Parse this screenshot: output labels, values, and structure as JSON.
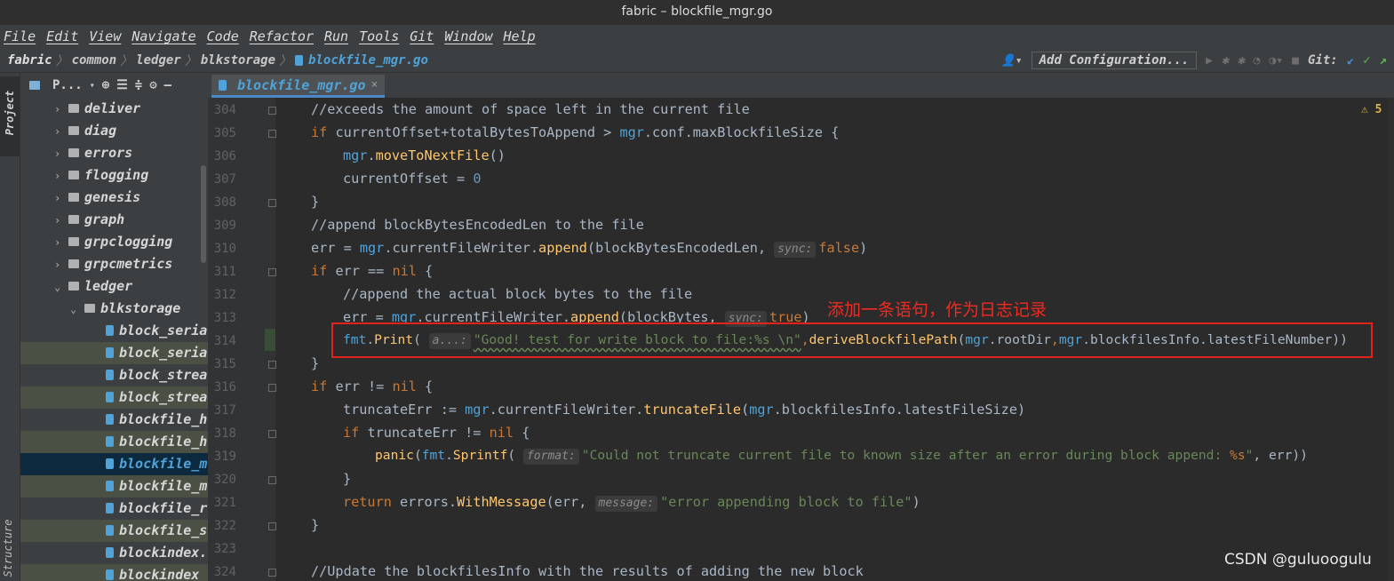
{
  "window": {
    "title": "fabric – blockfile_mgr.go"
  },
  "menu": [
    "File",
    "Edit",
    "View",
    "Navigate",
    "Code",
    "Refactor",
    "Run",
    "Tools",
    "Git",
    "Window",
    "Help"
  ],
  "breadcrumb": [
    "fabric",
    "common",
    "ledger",
    "blkstorage",
    "blockfile_mgr.go"
  ],
  "toolbar": {
    "add_configuration": "Add Configuration...",
    "git_label": "Git:"
  },
  "project_panel": {
    "header": "P...",
    "tab_label": "Project",
    "structure_label": "Structure",
    "items": [
      {
        "label": "deliver",
        "kind": "folder",
        "expanded": false
      },
      {
        "label": "diag",
        "kind": "folder",
        "expanded": false
      },
      {
        "label": "errors",
        "kind": "folder",
        "expanded": false
      },
      {
        "label": "flogging",
        "kind": "folder",
        "expanded": false
      },
      {
        "label": "genesis",
        "kind": "folder",
        "expanded": false
      },
      {
        "label": "graph",
        "kind": "folder",
        "expanded": false
      },
      {
        "label": "grpclogging",
        "kind": "folder",
        "expanded": false
      },
      {
        "label": "grpcmetrics",
        "kind": "folder",
        "expanded": false
      },
      {
        "label": "ledger",
        "kind": "folder",
        "expanded": true
      },
      {
        "label": "blkstorage",
        "kind": "folder",
        "expanded": true
      },
      {
        "label": "block_seria",
        "kind": "file"
      },
      {
        "label": "block_seria",
        "kind": "file"
      },
      {
        "label": "block_strea",
        "kind": "file"
      },
      {
        "label": "block_strea",
        "kind": "file"
      },
      {
        "label": "blockfile_h",
        "kind": "file"
      },
      {
        "label": "blockfile_h",
        "kind": "file"
      },
      {
        "label": "blockfile_m",
        "kind": "file",
        "selected": true
      },
      {
        "label": "blockfile_m",
        "kind": "file"
      },
      {
        "label": "blockfile_r",
        "kind": "file"
      },
      {
        "label": "blockfile_s",
        "kind": "file"
      },
      {
        "label": "blockindex.",
        "kind": "file"
      },
      {
        "label": "blockindex",
        "kind": "file"
      }
    ]
  },
  "editor": {
    "tab": "blockfile_mgr.go",
    "warnings": "5",
    "lines": [
      {
        "num": "304",
        "code": "//exceeds the amount of space left in the current file"
      },
      {
        "num": "305",
        "code": "if currentOffset+totalBytesToAppend > mgr.conf.maxBlockfileSize {"
      },
      {
        "num": "306",
        "code": "mgr.moveToNextFile()"
      },
      {
        "num": "307",
        "code": "currentOffset = 0"
      },
      {
        "num": "308",
        "code": "}"
      },
      {
        "num": "309",
        "code": "//append blockBytesEncodedLen to the file"
      },
      {
        "num": "310",
        "code": "err = mgr.currentFileWriter.append(blockBytesEncodedLen, sync: false)"
      },
      {
        "num": "311",
        "code": "if err == nil {"
      },
      {
        "num": "312",
        "code": "//append the actual block bytes to the file"
      },
      {
        "num": "313",
        "code": "err = mgr.currentFileWriter.append(blockBytes, sync: true)"
      },
      {
        "num": "314",
        "code": "fmt.Print( a...: \"Good! test for write block to file:%s \\n\",deriveBlockfilePath(mgr.rootDir,mgr.blockfilesInfo.latestFileNumber))"
      },
      {
        "num": "315",
        "code": "}"
      },
      {
        "num": "316",
        "code": "if err != nil {"
      },
      {
        "num": "317",
        "code": "truncateErr := mgr.currentFileWriter.truncateFile(mgr.blockfilesInfo.latestFileSize)"
      },
      {
        "num": "318",
        "code": "if truncateErr != nil {"
      },
      {
        "num": "319",
        "code": "panic(fmt.Sprintf( format: \"Could not truncate current file to known size after an error during block append: %s\", err))"
      },
      {
        "num": "320",
        "code": "}"
      },
      {
        "num": "321",
        "code": "return errors.WithMessage(err, message: \"error appending block to file\")"
      },
      {
        "num": "322",
        "code": "}"
      },
      {
        "num": "323",
        "code": ""
      },
      {
        "num": "324",
        "code": "//Update the blockfilesInfo with the results of adding the new block"
      }
    ],
    "tokens": {
      "l305_if": "if",
      "l305_a": " currentOffset+totalBytesToAppend > ",
      "l305_mgr": "mgr",
      "l305_b": ".conf.maxBlockfileSize {",
      "l306_mgr": "mgr",
      "l306_dot": ".",
      "l306_fn": "moveToNextFile",
      "l306_par": "()",
      "l307_a": "currentOffset = ",
      "l307_n": "0",
      "l310_a": "err = ",
      "l310_mgr": "mgr",
      "l310_b": ".currentFileWriter.",
      "l310_fn": "append",
      "l310_c": "(blockBytesEncodedLen, ",
      "l310_hint": "sync:",
      "l310_lit": "false",
      "l310_d": ")",
      "l311_if": "if",
      "l311_a": " err == ",
      "l311_nil": "nil",
      "l311_b": " {",
      "l313_a": "err = ",
      "l313_mgr": "mgr",
      "l313_b": ".currentFileWriter.",
      "l313_fn": "append",
      "l313_c": "(blockBytes, ",
      "l313_hint": "sync:",
      "l313_lit": "true",
      "l313_d": ")",
      "l314_fmt": "fmt",
      "l314_a": ".",
      "l314_fn": "Print",
      "l314_b": "( ",
      "l314_hint": "a...:",
      "l314_str": "\"Good! test for write block to file:%s \\n\"",
      "l314_comma": ",",
      "l314_fn2": "deriveBlockfilePath",
      "l314_c": "(",
      "l314_mgr1": "mgr",
      "l314_d": ".rootDir",
      "l314_comma2": ",",
      "l314_mgr2": "mgr",
      "l314_e": ".blockfilesInfo.latestFileNumber))",
      "l316_if": "if",
      "l316_a": " err != ",
      "l316_nil": "nil",
      "l316_b": " {",
      "l317_a": "truncateErr := ",
      "l317_mgr": "mgr",
      "l317_b": ".currentFileWriter.",
      "l317_fn": "truncateFile",
      "l317_c": "(",
      "l317_mgr2": "mgr",
      "l317_d": ".blockfilesInfo.latestFileSize)",
      "l318_if": "if",
      "l318_a": " truncateErr != ",
      "l318_nil": "nil",
      "l318_b": " {",
      "l319_fn": "panic",
      "l319_a": "(",
      "l319_fmt": "fmt",
      "l319_b": ".",
      "l319_fn2": "Sprintf",
      "l319_c": "( ",
      "l319_hint": "format:",
      "l319_str": "\"Could not truncate current file to known size after an error during block append: ",
      "l319_fmt2": "%s",
      "l319_str2": "\"",
      "l319_d": ", err))",
      "l321_ret": "return",
      "l321_a": " errors.",
      "l321_fn": "WithMessage",
      "l321_b": "(err, ",
      "l321_hint": "message:",
      "l321_str": "\"error appending block to file\"",
      "l321_c": ")"
    }
  },
  "annotation": "添加一条语句，作为日志记录",
  "watermark": "CSDN @guluoogulu",
  "colors": {
    "keyword": "#cc7832",
    "comment": "#808080",
    "function": "#ffc66d",
    "string": "#6a8759",
    "number": "#6897bb",
    "highlight_box": "#e3221c"
  }
}
